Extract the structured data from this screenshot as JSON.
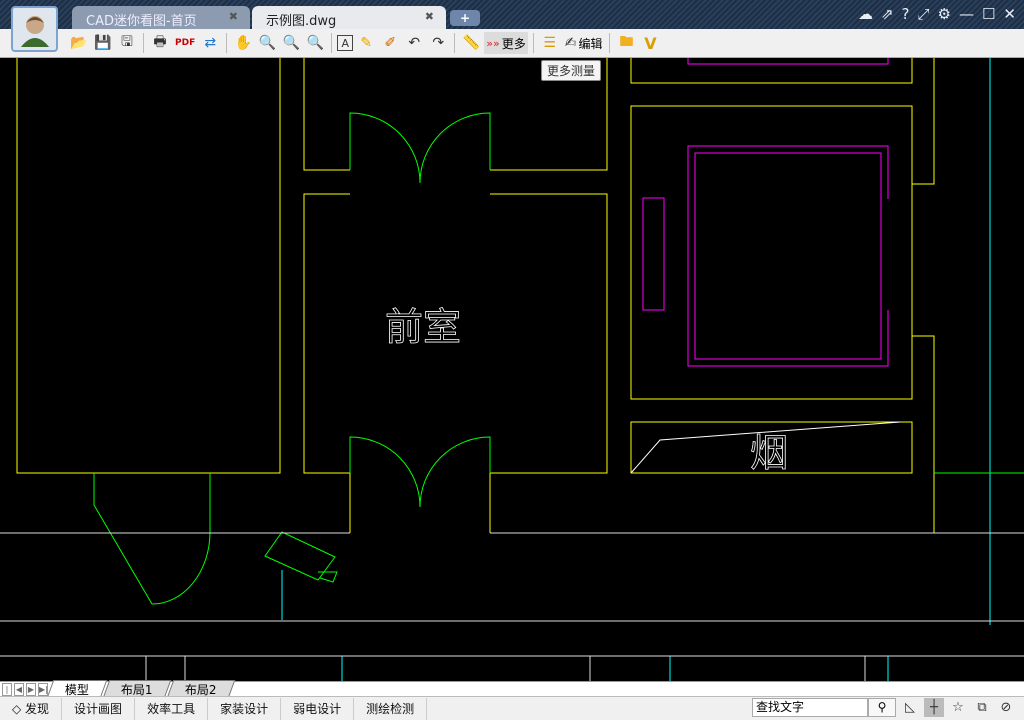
{
  "tabs": [
    {
      "label": "CAD迷你看图-首页"
    },
    {
      "label": "示例图.dwg",
      "active": true
    }
  ],
  "window_controls": [
    "cloud-icon",
    "share-icon",
    "help-icon",
    "fullscreen-icon",
    "settings-icon",
    "minimize-icon",
    "maximize-icon",
    "close-icon"
  ],
  "toolbar": {
    "more_label": "更多",
    "edit_label": "编辑",
    "tooltip": "更多测量"
  },
  "drawing": {
    "room_label": "前室",
    "chimney_label": "烟"
  },
  "colors": {
    "walls": "#ffff00",
    "doors": "#00ff00",
    "fixtures": "#ff00ff",
    "axes": "#00ffff"
  },
  "layout_tabs": [
    "模型",
    "布局1",
    "布局2"
  ],
  "statusbar": {
    "items": [
      "◇ 发现",
      "设计画图",
      "效率工具",
      "家装设计",
      "弱电设计",
      "测绘检测"
    ],
    "search_placeholder": "查找文字"
  }
}
